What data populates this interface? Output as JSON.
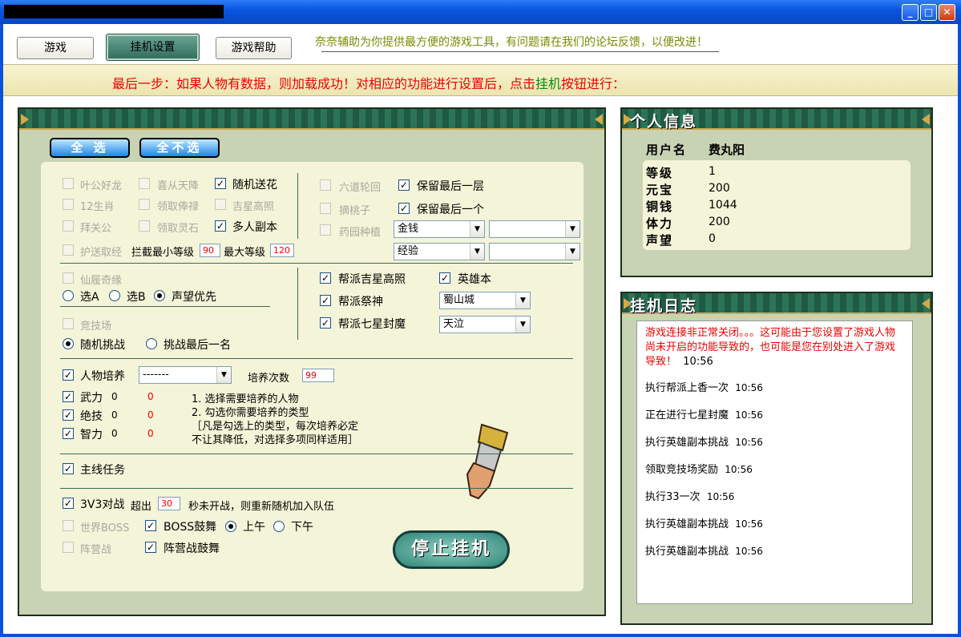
{
  "window": {
    "minimize": "_",
    "maximize": "□",
    "close": "✕"
  },
  "tabs": [
    "游戏",
    "挂机设置",
    "游戏帮助"
  ],
  "slogan": "奈奈辅助为你提供最方便的游戏工具，有问题请在我们的论坛反馈，以便改进！",
  "banner": {
    "part1": "最后一步：如果人物有数据，则加载成功！对相应的功能进行设置后，点击",
    "highlight": "挂机",
    "part2": "按钮进行："
  },
  "settings": {
    "select_all": "全 选",
    "select_none": "全不选",
    "col1": [
      {
        "label": "叶公好龙",
        "checked": false,
        "enabled": false
      },
      {
        "label": "12生肖",
        "checked": false,
        "enabled": false
      },
      {
        "label": "拜关公",
        "checked": false,
        "enabled": false
      },
      {
        "label": "护送取经",
        "checked": false,
        "enabled": false
      }
    ],
    "col2": [
      {
        "label": "喜从天降",
        "checked": false,
        "enabled": false
      },
      {
        "label": "领取俸禄",
        "checked": false,
        "enabled": false
      },
      {
        "label": "领取灵石",
        "checked": false,
        "enabled": false
      }
    ],
    "col3": [
      {
        "label": "随机送花",
        "checked": true,
        "enabled": true
      },
      {
        "label": "吉星高照",
        "checked": false,
        "enabled": false
      },
      {
        "label": "多人副本",
        "checked": true,
        "enabled": true
      }
    ],
    "intercept": {
      "min_label": "拦截最小等级",
      "min": "90",
      "max_label": "最大等级",
      "max": "120"
    },
    "col4": [
      {
        "label": "六道轮回",
        "checked": false,
        "enabled": false
      },
      {
        "label": "摘桃子",
        "checked": false,
        "enabled": false
      },
      {
        "label": "药园种植",
        "checked": false,
        "enabled": false
      }
    ],
    "keep_last_layer": "保留最后一层",
    "keep_last_one": "保留最后一个",
    "sel_money": "金钱",
    "sel_exp": "经验",
    "xianlu": {
      "label": "仙履奇缘",
      "opt_a": "选A",
      "opt_b": "选B",
      "opt_rep": "声望优先"
    },
    "arena": {
      "label": "竞技场",
      "random": "随机挑战",
      "last": "挑战最后一名"
    },
    "guild": [
      {
        "label": "帮派吉星高照",
        "checked": true
      },
      {
        "label": "帮派祭神",
        "checked": true
      },
      {
        "label": "帮派七星封魔",
        "checked": true
      }
    ],
    "hero": {
      "label": "英雄本",
      "checked": true,
      "map": "蜀山城",
      "boss": "天泣"
    },
    "train": {
      "label": "人物培养",
      "select": "-------",
      "count_label": "培养次数",
      "count": "99",
      "stats": [
        {
          "label": "武力",
          "v1": "0",
          "v2": "0"
        },
        {
          "label": "绝技",
          "v1": "0",
          "v2": "0"
        },
        {
          "label": "智力",
          "v1": "0",
          "v2": "0"
        }
      ],
      "help1": "1. 选择需要培养的人物",
      "help2": "2. 勾选你需要培养的类型",
      "help3": "［凡是勾选上的类型，每次培养必定",
      "help4": "不让其降低，对选择多项同样适用］"
    },
    "main_quest": "主线任务",
    "v3": {
      "label": "3V3对战",
      "pre": "超出",
      "sec": "30",
      "post": "秒未开战，则重新随机加入队伍"
    },
    "world_boss": "世界BOSS",
    "boss_drum": "BOSS鼓舞",
    "am": "上午",
    "pm": "下午",
    "camp": "阵营战",
    "camp_drum": "阵营战鼓舞",
    "stop": "停止挂机"
  },
  "info": {
    "title": "个人信息",
    "user_label": "用户名",
    "user": "费丸阳",
    "rows": [
      {
        "k": "等级",
        "v": "1"
      },
      {
        "k": "元宝",
        "v": "200"
      },
      {
        "k": "铜钱",
        "v": "1044"
      },
      {
        "k": "体力",
        "v": "200"
      },
      {
        "k": "声望",
        "v": "0"
      }
    ]
  },
  "log": {
    "title": "挂机日志",
    "error": "游戏连接非正常关闭。。。这可能由于您设置了游戏人物尚未开启的功能导致的，也可能是您在别处进入了游戏导致！",
    "error_time": "10:56",
    "entries": [
      {
        "t": "执行帮派上香一次",
        "time": "10:56"
      },
      {
        "t": "正在进行七星封魔",
        "time": "10:56"
      },
      {
        "t": "执行英雄副本挑战",
        "time": "10:56"
      },
      {
        "t": "领取竞技场奖励",
        "time": "10:56"
      },
      {
        "t": "执行33一次",
        "time": "10:56"
      },
      {
        "t": "执行英雄副本挑战",
        "time": "10:56"
      },
      {
        "t": "执行英雄副本挑战",
        "time": "10:56"
      }
    ]
  }
}
